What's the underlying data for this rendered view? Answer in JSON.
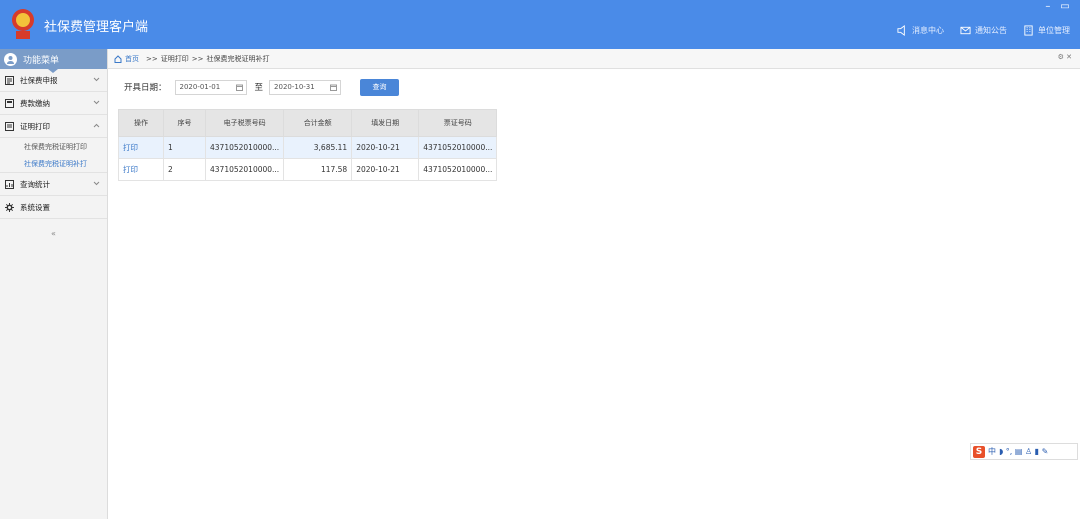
{
  "app": {
    "title": "社保费管理客户端"
  },
  "window": {
    "minimize": "–",
    "restore": "▭"
  },
  "top_actions": [
    {
      "icon": "speaker-icon",
      "label": "消息中心"
    },
    {
      "icon": "envelope-icon",
      "label": "通知公告"
    },
    {
      "icon": "building-icon",
      "label": "单位管理"
    }
  ],
  "sidebar": {
    "header": "功能菜单",
    "items": [
      {
        "label": "社保费申报",
        "icon": "list-icon"
      },
      {
        "label": "费款缴纳",
        "icon": "calculator-icon"
      },
      {
        "label": "证明打印",
        "icon": "print-icon",
        "expanded": true,
        "children": [
          "社保费完税证明打印",
          "社保费完税证明补打"
        ]
      },
      {
        "label": "查询统计",
        "icon": "chart-icon"
      },
      {
        "label": "系统设置",
        "icon": "gear-icon"
      }
    ],
    "collapse": "«"
  },
  "breadcrumb": {
    "home": "首页",
    "sep": ">>",
    "level1": "证明打印",
    "level2": "社保费完税证明补打",
    "right": "⚙ ✕"
  },
  "filters": {
    "label": "开具日期：",
    "start": "2020-01-01",
    "to": "至",
    "end": "2020-10-31",
    "query": "查询"
  },
  "table": {
    "headers": [
      "操作",
      "序号",
      "电子税票号码",
      "合计金额",
      "填发日期",
      "票证号码"
    ],
    "rows": [
      [
        "打印",
        "1",
        "4371052010000...",
        "3,685.11",
        "2020-10-21",
        "4371052010000..."
      ],
      [
        "打印",
        "2",
        "4371052010000...",
        "117.58",
        "2020-10-21",
        "4371052010000..."
      ]
    ]
  },
  "ime": {
    "logo": "S",
    "mode": "中",
    "symbols": "◗ °, ▤ ♙ ▮ ✎"
  },
  "colors": {
    "titlebar": "#4a8be8",
    "accent": "#3a78c8"
  }
}
